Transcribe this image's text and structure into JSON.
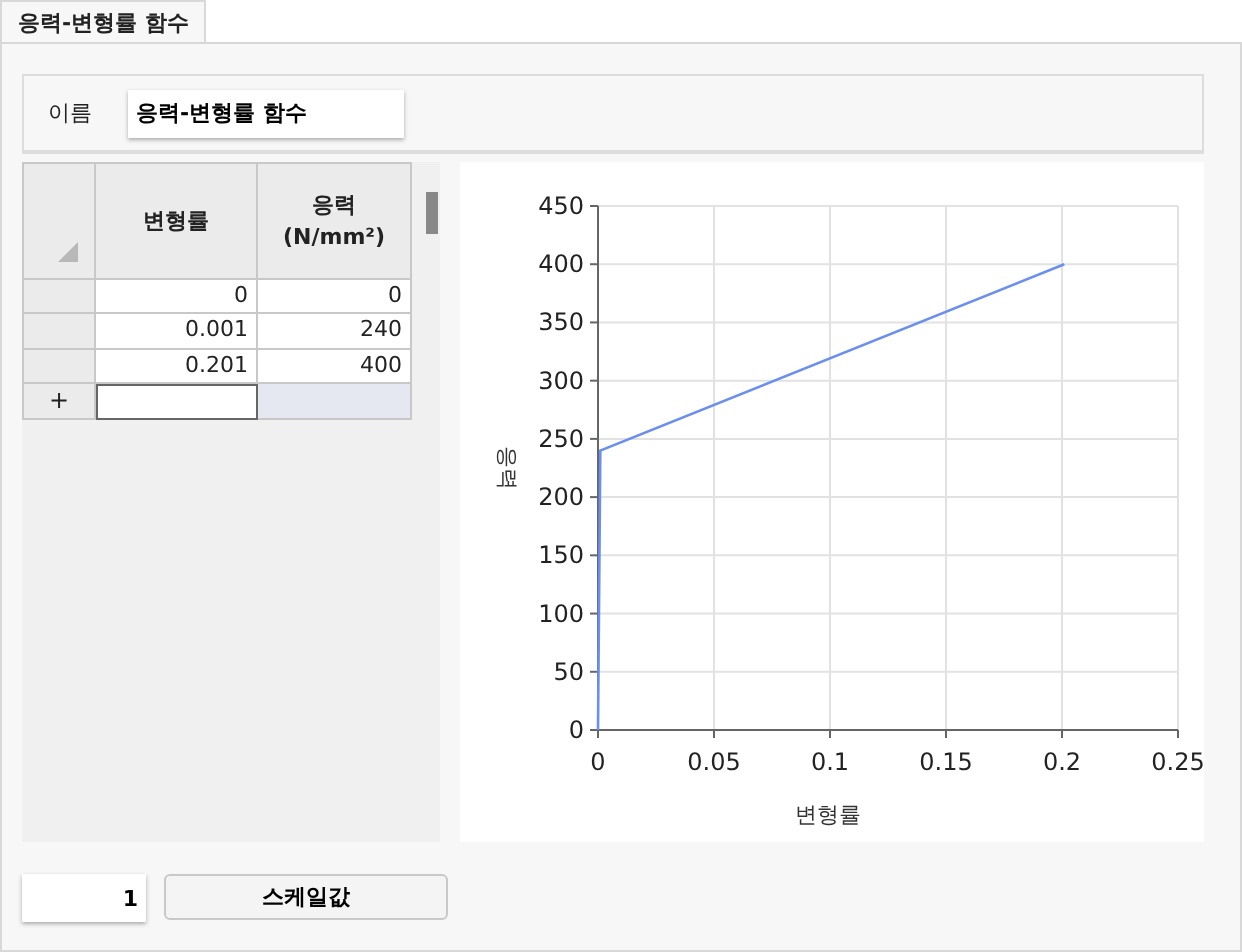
{
  "tabs": [
    {
      "label": "응력-변형률 함수",
      "selected": true
    }
  ],
  "name_field": {
    "label": "이름",
    "value": "응력-변형률 함수"
  },
  "table": {
    "columns": [
      {
        "label": "변형률"
      },
      {
        "label": "응력",
        "unit": "(N/mm²)"
      }
    ],
    "rows": [
      [
        "0",
        "0"
      ],
      [
        "0.001",
        "240"
      ],
      [
        "0.201",
        "400"
      ]
    ],
    "new_row_marker": "+"
  },
  "chart": {
    "chart_data": {
      "type": "line",
      "xlabel": "변형률",
      "ylabel": "응력",
      "x": [
        0,
        0.001,
        0.201
      ],
      "series": [
        {
          "color": "#6a8ff0",
          "values": [
            0,
            240,
            400
          ]
        }
      ],
      "grid": true,
      "xlim": [
        0,
        0.25
      ],
      "ylim": [
        0,
        450
      ],
      "xticks": [
        0,
        0.05,
        0.1,
        0.15,
        0.2,
        0.25
      ],
      "yticks": [
        0,
        50,
        100,
        150,
        200,
        250,
        300,
        350,
        400,
        450
      ]
    }
  },
  "scale": {
    "value": "1",
    "button": "스케일값"
  }
}
